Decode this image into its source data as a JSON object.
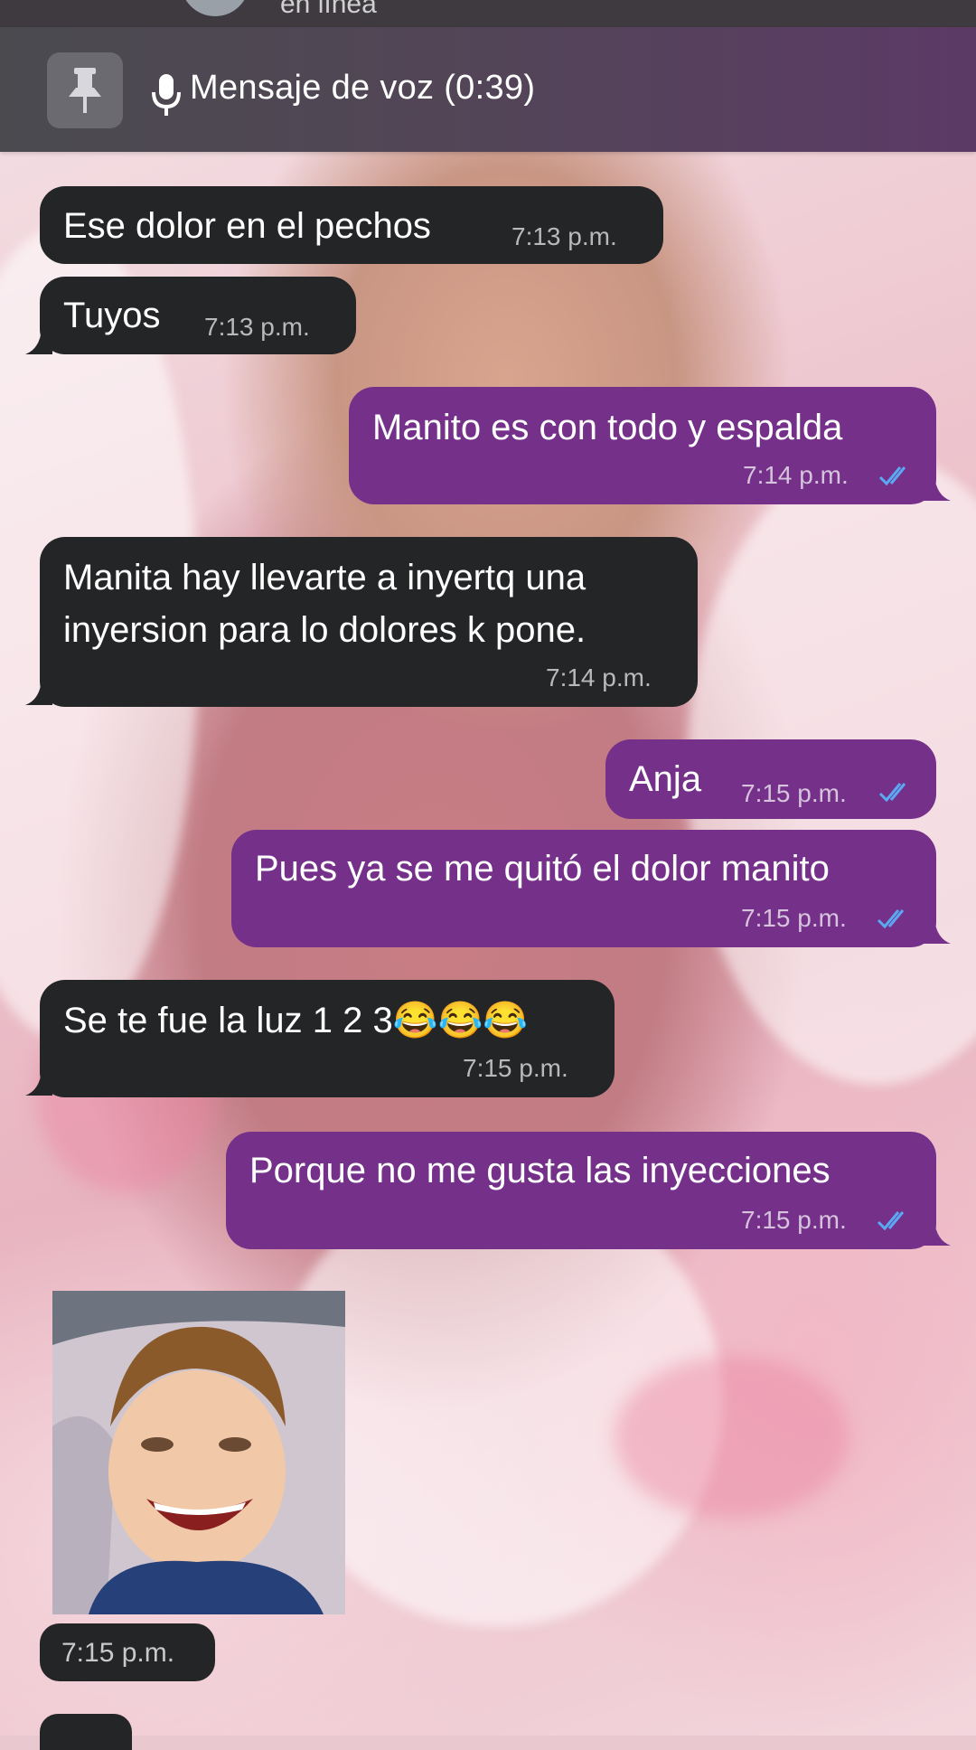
{
  "header": {
    "status_text": "en línea",
    "pinned_label": "Mensaje de voz (0:39)"
  },
  "messages": [
    {
      "text": "Ese dolor en el pechos",
      "time": "7:13 p.m."
    },
    {
      "text": "Tuyos",
      "time": "7:13 p.m."
    },
    {
      "text": "Manito es con todo y espalda",
      "time": "7:14 p.m."
    },
    {
      "line1": "Manita hay llevarte a inyertq una",
      "line2": "inyersion para lo dolores k pone.",
      "time": "7:14 p.m."
    },
    {
      "text": "Anja",
      "time": "7:15 p.m."
    },
    {
      "text": "Pues ya se me quitó el dolor manito",
      "time": "7:15 p.m."
    },
    {
      "text": "Se te fue la luz 1 2 3😂😂😂",
      "time": "7:15 p.m."
    },
    {
      "text": "Porque no me gusta las inyecciones",
      "time": "7:15 p.m."
    },
    {
      "time": "7:15 p.m."
    }
  ],
  "colors": {
    "incoming_bubble": "#232526",
    "outgoing_bubble": "#75308a",
    "read_ticks": "#5aa9f2"
  },
  "icons": {
    "pin": "pin-icon",
    "mic": "microphone-icon",
    "read": "double-check-icon"
  }
}
